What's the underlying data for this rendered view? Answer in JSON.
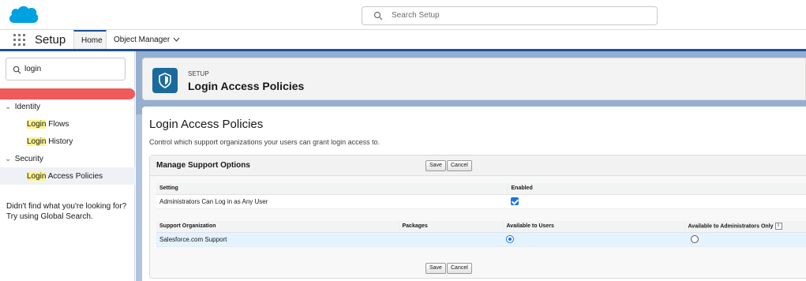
{
  "topbar": {
    "logo": "salesforce-cloud-logo",
    "search_placeholder": "Search Setup"
  },
  "nav": {
    "app_name": "Setup",
    "tabs": [
      {
        "label": "Home",
        "active": true
      },
      {
        "label": "Object Manager",
        "active": false
      }
    ]
  },
  "sidebar": {
    "quick_find_value": "login",
    "highlight_term": "Login",
    "groups": [
      {
        "label": "Identity",
        "items": [
          {
            "rest": " Flows",
            "active": false
          },
          {
            "rest": " History",
            "active": false
          }
        ]
      },
      {
        "label": "Security",
        "items": [
          {
            "rest": " Access Policies",
            "active": true
          }
        ]
      }
    ],
    "not_found_line1": "Didn't find what you're looking for?",
    "not_found_line2": "Try using Global Search."
  },
  "header": {
    "eyebrow": "SETUP",
    "title": "Login Access Policies",
    "icon": "shield-icon"
  },
  "page": {
    "title": "Login Access Policies",
    "description": "Control which support organizations your users can grant login access to."
  },
  "block": {
    "title": "Manage Support Options",
    "save_label": "Save",
    "cancel_label": "Cancel",
    "settings_table": {
      "headers": [
        "Setting",
        "Enabled"
      ],
      "rows": [
        {
          "setting": "Administrators Can Log in as Any User",
          "enabled": true
        }
      ]
    },
    "support_table": {
      "headers": [
        "Support Organization",
        "Packages",
        "Available to Users",
        "Available to Administrators Only"
      ],
      "info_icon": "i",
      "rows": [
        {
          "organization": "Salesforce.com Support",
          "packages": "",
          "available_to_users": true,
          "available_to_admins_only": false
        }
      ]
    }
  },
  "colors": {
    "brand_blue": "#1b5297",
    "logo_blue": "#00a1e0",
    "highlight_yellow": "#fef38a",
    "red_bar": "#ef5a5a",
    "checkbox_blue": "#1a73e8"
  }
}
